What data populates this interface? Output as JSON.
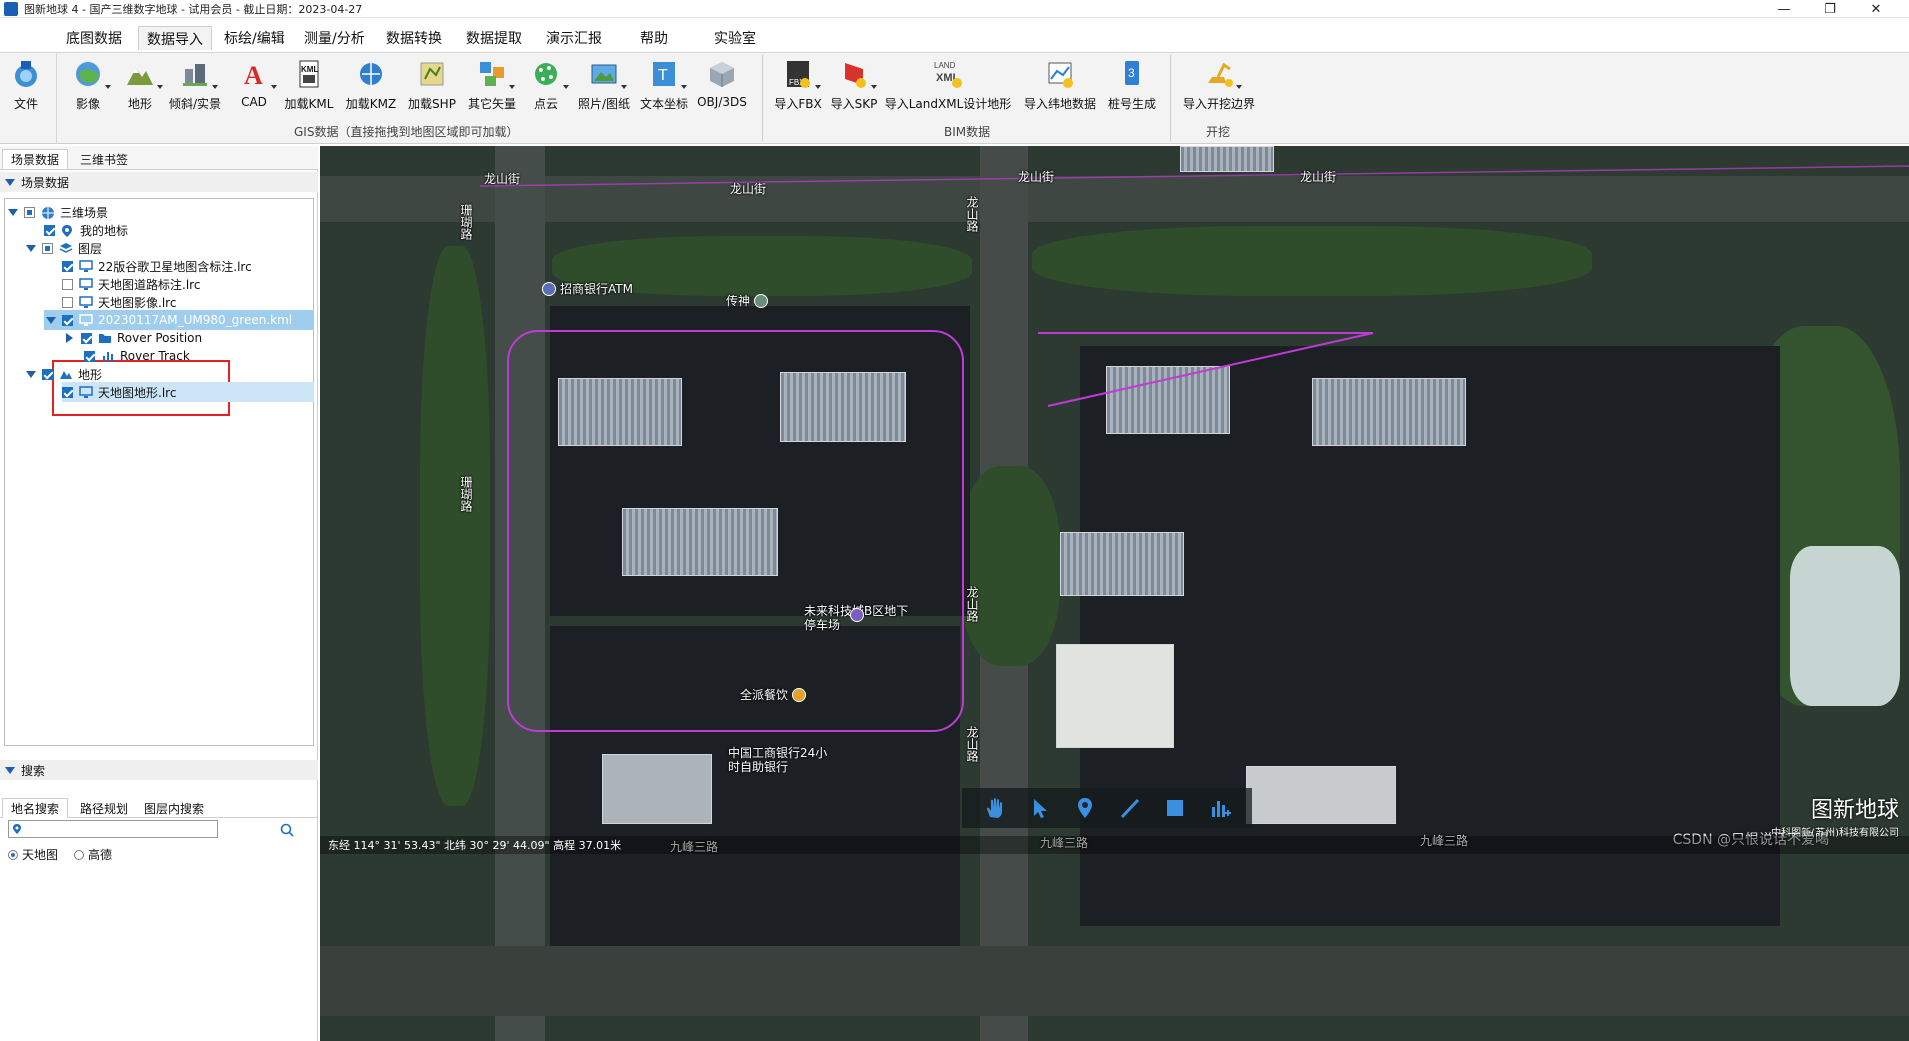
{
  "window": {
    "title": "图新地球 4 - 国产三维数字地球 - 试用会员 - 截止日期：2023-04-27",
    "minimize": "—",
    "restore": "❐",
    "close": "✕"
  },
  "menu": {
    "tabs": [
      "底图数据",
      "数据导入",
      "标绘/编辑",
      "测量/分析",
      "数据转换",
      "数据提取",
      "演示汇报",
      "帮助",
      "实验室"
    ],
    "active_index": 1
  },
  "ribbon": {
    "file": "文件",
    "gis_buttons": [
      "影像",
      "地形",
      "倾斜/实景",
      "CAD",
      "加载KML",
      "加载KMZ",
      "加载SHP",
      "其它矢量",
      "点云",
      "照片/图纸",
      "文本坐标",
      "OBJ/3DS"
    ],
    "gis_group_label": "GIS数据（直接拖拽到地图区域即可加载）",
    "bim_buttons": [
      "导入FBX",
      "导入SKP",
      "导入LandXML设计地形",
      "导入纬地数据",
      "桩号生成"
    ],
    "bim_group_label": "BIM数据",
    "excavation_buttons": [
      "导入开挖边界"
    ],
    "excavation_group_label": "开挖",
    "icon_texts": {
      "kml": "KML",
      "cad": "A",
      "fbx": "FBX",
      "land": "LAND",
      "xml": "XML",
      "pile": "3"
    }
  },
  "left_panel": {
    "tabs": [
      "场景数据",
      "三维书签"
    ],
    "scene_section": "场景数据",
    "tree": {
      "root": "三维场景",
      "my_places": "我的地标",
      "layers": "图层",
      "layer_items": [
        "22版谷歌卫星地图含标注.lrc",
        "天地图道路标注.lrc",
        "天地图影像.lrc"
      ],
      "kml": "20230117AM_UM980_green.kml",
      "kml_children": [
        "Rover Position",
        "Rover Track"
      ],
      "terrain": "地形",
      "terrain_item": "天地图地形.lrc"
    },
    "search_section": "搜索",
    "search_tabs": [
      "地名搜索",
      "路径规划",
      "图层内搜索"
    ],
    "search_placeholder": "",
    "sources": [
      "天地图",
      "高德"
    ],
    "selected_source": "天地图"
  },
  "map": {
    "roads": {
      "longshan_street": "龙山街",
      "longshan_road": "龙山路",
      "jiufeng_3": "九峰三路",
      "side_road": "珊瑚路"
    },
    "pois": {
      "atm": "招商银行ATM",
      "chuanshen": "传神",
      "parking": "未来科技城B区地下停车场",
      "restaurant": "全派餐饮",
      "bank": "中国工商银行24小时自助银行"
    },
    "status": "东经 114° 31' 53.43\"  北纬 30° 29' 44.09\"  高程 37.01米",
    "brand": "图新地球",
    "brand_sub": "中科图新(苏州)科技有限公司",
    "watermark": "CSDN @只恨说话不爱喝"
  },
  "colors": {
    "accent": "#1f6fc0",
    "selection": "#cde6f7",
    "highlight_box": "#e52222",
    "track_line": "#c03ad6"
  }
}
